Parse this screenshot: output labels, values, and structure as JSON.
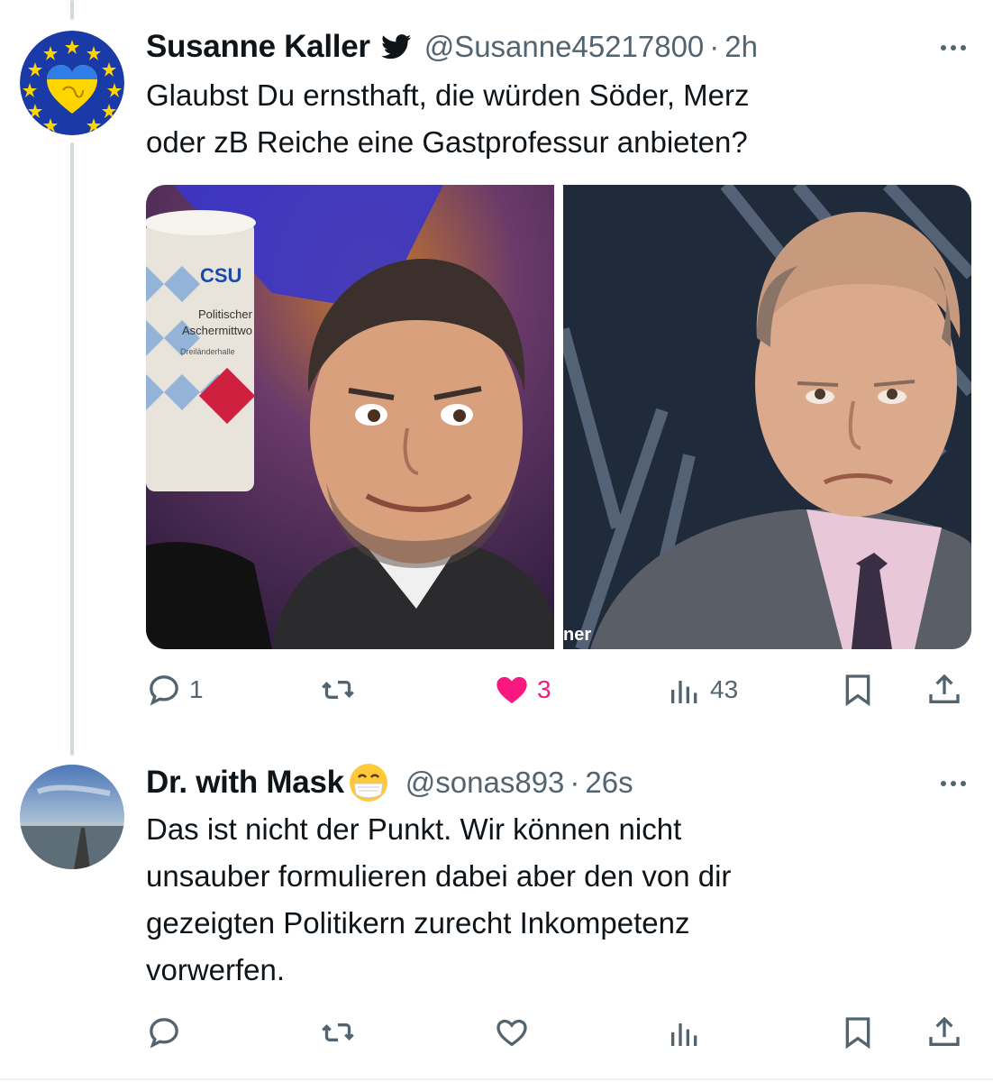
{
  "tweets": [
    {
      "author": {
        "name": "Susanne Kaller",
        "handle": "@Susanne45217800",
        "time": "2h"
      },
      "text_lines": [
        "Glaubst Du ernsthaft, die würden Söder, Merz",
        "oder zB Reiche eine Gastprofessur anbieten?"
      ],
      "media": {
        "left_mug": {
          "brand": "CSU",
          "line1": "Politischer",
          "line2": "Aschermittwo",
          "line3": "Dreiländerhalle"
        },
        "right_caption": "ner"
      },
      "actions": {
        "replies": "1",
        "retweets": "",
        "likes": "3",
        "views": "43"
      },
      "liked": true
    },
    {
      "author": {
        "name": "Dr. with Mask",
        "handle": "@sonas893",
        "time": "26s"
      },
      "text_lines": [
        "Das ist nicht der Punkt. Wir können nicht",
        "unsauber formulieren dabei aber den von dir",
        "gezeigten Politikern zurecht Inkompetenz",
        "vorwerfen."
      ],
      "actions": {
        "replies": "",
        "retweets": "",
        "likes": "",
        "views": ""
      },
      "liked": false
    }
  ],
  "colors": {
    "like_active": "#f91880",
    "muted": "#536471",
    "text": "#0f1419",
    "thread_line": "#cfd9de"
  },
  "icons": [
    "twitter-bird-icon",
    "more-icon",
    "reply-icon",
    "retweet-icon",
    "heart-icon",
    "views-icon",
    "bookmark-icon",
    "share-icon",
    "mask-face-emoji-icon"
  ]
}
